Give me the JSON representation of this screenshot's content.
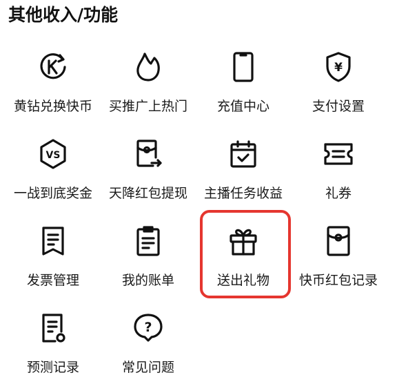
{
  "section": {
    "title": "其他收入/功能"
  },
  "highlight_color": "#e5362f",
  "items": [
    {
      "label": "黄钻兑换快币",
      "icon": "k-coin-exchange-icon"
    },
    {
      "label": "买推广上热门",
      "icon": "flame-icon"
    },
    {
      "label": "充值中心",
      "icon": "phone-icon"
    },
    {
      "label": "支付设置",
      "icon": "yuan-shield-icon"
    },
    {
      "label": "一战到底奖金",
      "icon": "vs-badge-icon"
    },
    {
      "label": "天降红包提现",
      "icon": "red-packet-withdraw-icon"
    },
    {
      "label": "主播任务收益",
      "icon": "calendar-check-icon"
    },
    {
      "label": "礼券",
      "icon": "ticket-icon"
    },
    {
      "label": "发票管理",
      "icon": "invoice-icon"
    },
    {
      "label": "我的账单",
      "icon": "bill-icon"
    },
    {
      "label": "送出礼物",
      "icon": "gift-icon"
    },
    {
      "label": "快币红包记录",
      "icon": "red-packet-record-icon"
    },
    {
      "label": "预测记录",
      "icon": "prediction-record-icon"
    },
    {
      "label": "常见问题",
      "icon": "question-icon"
    }
  ],
  "icon_text": {
    "k": "K",
    "vs": "VS",
    "yuan": "¥",
    "question": "?"
  }
}
